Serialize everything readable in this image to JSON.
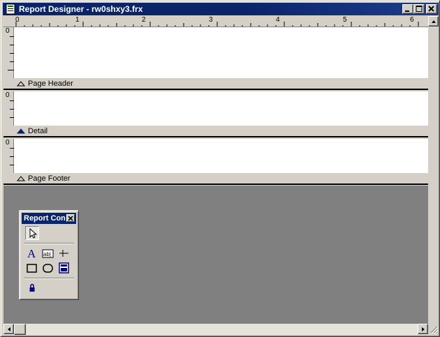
{
  "window": {
    "title": "Report Designer - rw0shxy3.frx"
  },
  "ruler": {
    "labels": [
      "0",
      "1",
      "2",
      "3",
      "4",
      "5",
      "6"
    ]
  },
  "bands": [
    {
      "label": "Page Header",
      "ruler_zero": "0",
      "selected": false
    },
    {
      "label": "Detail",
      "ruler_zero": "0",
      "selected": true
    },
    {
      "label": "Page Footer",
      "ruler_zero": "0",
      "selected": false
    }
  ],
  "toolbox": {
    "title": "Report Controls",
    "tools": [
      "pointer-icon",
      "label-icon",
      "field-icon",
      "line-icon",
      "rectangle-icon",
      "rounded-rectangle-icon",
      "picture-ole-icon",
      "lock-icon"
    ]
  },
  "colors": {
    "titlebar": "#0a246a",
    "window_bg": "#d4d0c8",
    "workspace": "#808080",
    "band_bg": "#ffffff"
  }
}
